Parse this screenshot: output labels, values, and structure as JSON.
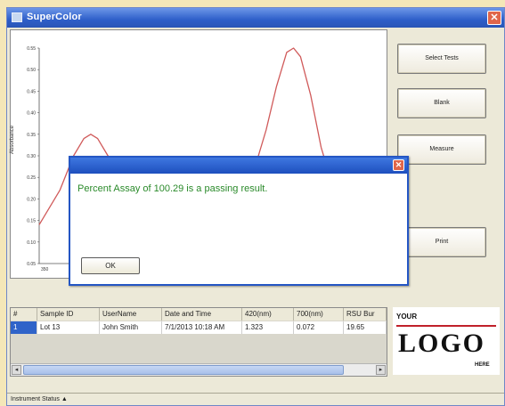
{
  "window": {
    "title": "SuperColor",
    "close_glyph": "✕"
  },
  "chart_data": {
    "type": "line",
    "ylabel": "Absorbance",
    "yticks": [
      "0.55",
      "0.50",
      "0.45",
      "0.40",
      "0.35",
      "0.30",
      "0.25",
      "0.20",
      "0.15",
      "0.10",
      "0.05"
    ],
    "xticks": [
      "350"
    ],
    "ylim": [
      0.05,
      0.55
    ],
    "series": [
      {
        "values": [
          [
            0,
            0.14
          ],
          [
            6,
            0.22
          ],
          [
            10,
            0.3
          ],
          [
            13,
            0.34
          ],
          [
            15,
            0.35
          ],
          [
            17,
            0.34
          ],
          [
            20,
            0.3
          ],
          [
            23,
            0.28
          ],
          [
            63,
            0.28
          ],
          [
            66,
            0.36
          ],
          [
            69,
            0.46
          ],
          [
            72,
            0.54
          ],
          [
            74,
            0.55
          ],
          [
            76,
            0.53
          ],
          [
            79,
            0.44
          ],
          [
            82,
            0.32
          ],
          [
            85,
            0.24
          ]
        ]
      }
    ],
    "line_color": "#d05a5a"
  },
  "buttons": {
    "select_tests": "Select Tests",
    "blank": "Blank",
    "measure": "Measure",
    "print": "Print"
  },
  "table": {
    "columns": [
      "#",
      "Sample ID",
      "UserName",
      "Date and Time",
      "420(nm)",
      "700(nm)",
      "RSU Bur"
    ],
    "rows": [
      [
        "1",
        "Lot 13",
        "John Smith",
        "7/1/2013 10:18 AM",
        "1.323",
        "0.072",
        "19.65"
      ]
    ]
  },
  "logo": {
    "your": "YOUR",
    "main": "LOGO",
    "here": "HERE"
  },
  "status": {
    "label": "Instrument Status",
    "icon": "status-icon"
  },
  "dialog": {
    "message": "Percent Assay of 100.29 is a passing result.",
    "ok": "OK",
    "close_glyph": "✕"
  },
  "colors": {
    "accent": "#2456c4",
    "message": "#2a8a2a"
  }
}
